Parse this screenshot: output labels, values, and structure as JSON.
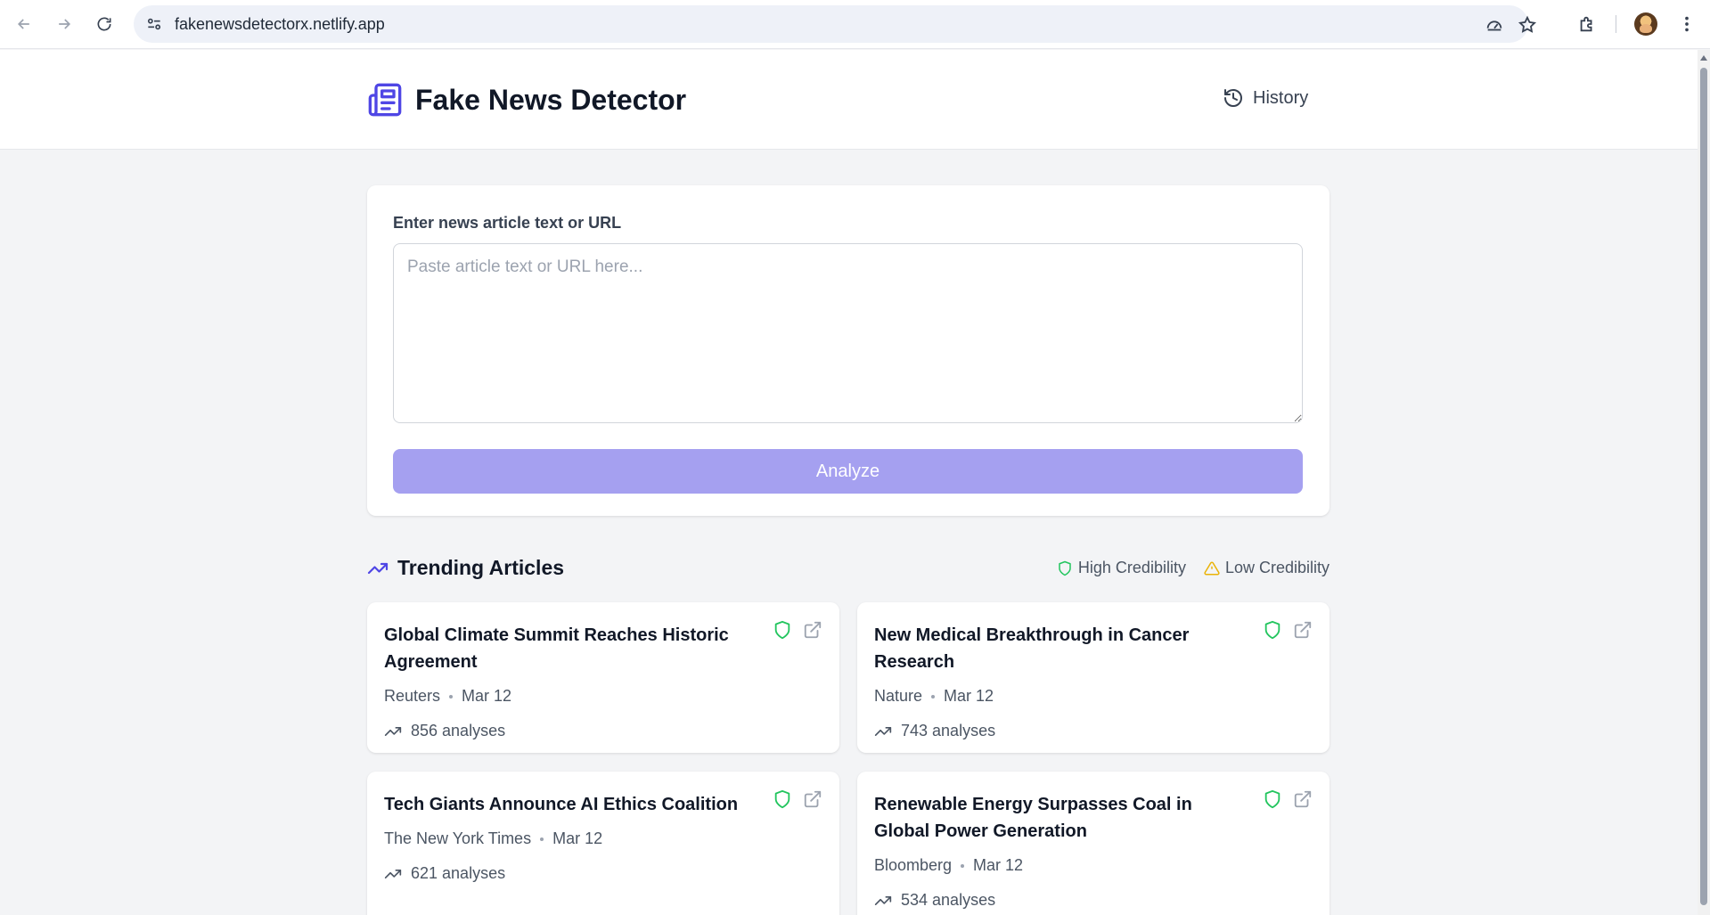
{
  "browser": {
    "url": "fakenewsdetectorx.netlify.app"
  },
  "header": {
    "title": "Fake News Detector",
    "history_label": "History"
  },
  "input_card": {
    "label": "Enter news article text or URL",
    "placeholder": "Paste article text or URL here...",
    "value": "",
    "analyze_label": "Analyze"
  },
  "trending": {
    "title": "Trending Articles",
    "legend_high": "High Credibility",
    "legend_low": "Low Credibility",
    "articles": [
      {
        "title": "Global Climate Summit Reaches Historic Agreement",
        "source": "Reuters",
        "date": "Mar 12",
        "analyses": "856 analyses",
        "credibility": "high"
      },
      {
        "title": "New Medical Breakthrough in Cancer Research",
        "source": "Nature",
        "date": "Mar 12",
        "analyses": "743 analyses",
        "credibility": "high"
      },
      {
        "title": "Tech Giants Announce AI Ethics Coalition",
        "source": "The New York Times",
        "date": "Mar 12",
        "analyses": "621 analyses",
        "credibility": "high"
      },
      {
        "title": "Renewable Energy Surpasses Coal in Global Power Generation",
        "source": "Bloomberg",
        "date": "Mar 12",
        "analyses": "534 analyses",
        "credibility": "high"
      }
    ]
  },
  "colors": {
    "brand": "#4f46e5",
    "analyze_button": "#a5a0f0",
    "high_credibility": "#22c55e",
    "low_credibility": "#eab308"
  }
}
